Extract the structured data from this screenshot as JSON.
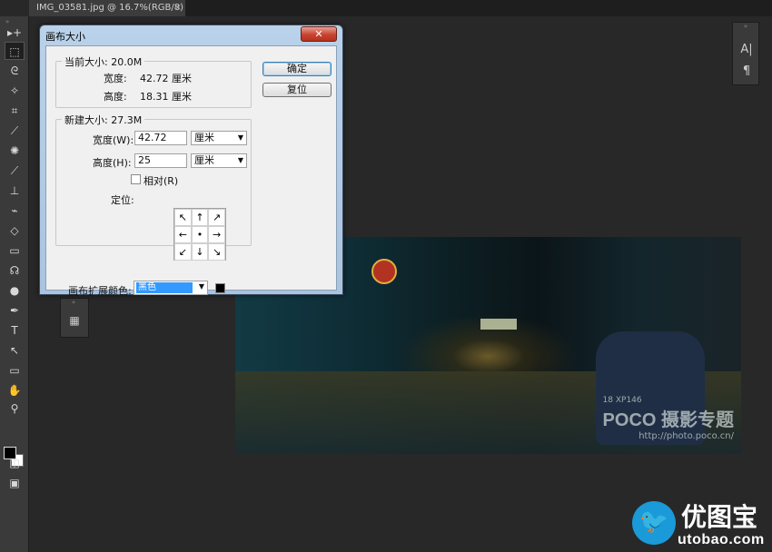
{
  "tab": {
    "label": "IMG_03581.jpg @ 16.7%(RGB/8)",
    "close": "×"
  },
  "tools": {
    "grip": "»",
    "items": [
      {
        "icon": "▸+"
      },
      {
        "icon": "⬚"
      },
      {
        "icon": "ᘓ"
      },
      {
        "icon": "✧"
      },
      {
        "icon": "⌗"
      },
      {
        "icon": "⟋"
      },
      {
        "icon": "✺"
      },
      {
        "icon": "⟋"
      },
      {
        "icon": "⊥"
      },
      {
        "icon": "⌁"
      },
      {
        "icon": "◇"
      },
      {
        "icon": "▭"
      },
      {
        "icon": "☊"
      },
      {
        "icon": "●"
      },
      {
        "icon": "✒"
      },
      {
        "icon": "T"
      },
      {
        "icon": "↖"
      },
      {
        "icon": "▭"
      },
      {
        "icon": "✋"
      },
      {
        "icon": "⚲"
      },
      {
        "icon": "◫"
      },
      {
        "icon": "▣"
      }
    ]
  },
  "char_panel": {
    "grip": "»",
    "char": "A|",
    "para": "¶"
  },
  "small_panel": {
    "grip": "»",
    "icon": "▦"
  },
  "photo": {
    "watermark": "POCO 摄影专题",
    "url": "http://photo.poco.cn/",
    "plate": "18 XP146"
  },
  "dialog": {
    "title": "画布大小",
    "close": "✕",
    "ok": "确定",
    "reset": "复位",
    "current": {
      "legend": "当前大小: 20.0M",
      "width_label": "宽度:",
      "width_value": "42.72 厘米",
      "height_label": "高度:",
      "height_value": "18.31 厘米"
    },
    "new": {
      "legend": "新建大小: 27.3M",
      "width_label": "宽度(W):",
      "width_value": "42.72",
      "width_unit": "厘米",
      "height_label": "高度(H):",
      "height_value": "25",
      "height_unit": "厘米",
      "relative_label": "相对(R)",
      "anchor_label": "定位:",
      "anchors": [
        "↖",
        "↑",
        "↗",
        "←",
        "•",
        "→",
        "↙",
        "↓",
        "↘"
      ]
    },
    "extension": {
      "label": "画布扩展颜色:",
      "value": "黑色",
      "swatch_color": "#000000"
    }
  },
  "site_logo": {
    "text": "优图宝",
    "url": "utobao.com",
    "mark": "🐦"
  }
}
